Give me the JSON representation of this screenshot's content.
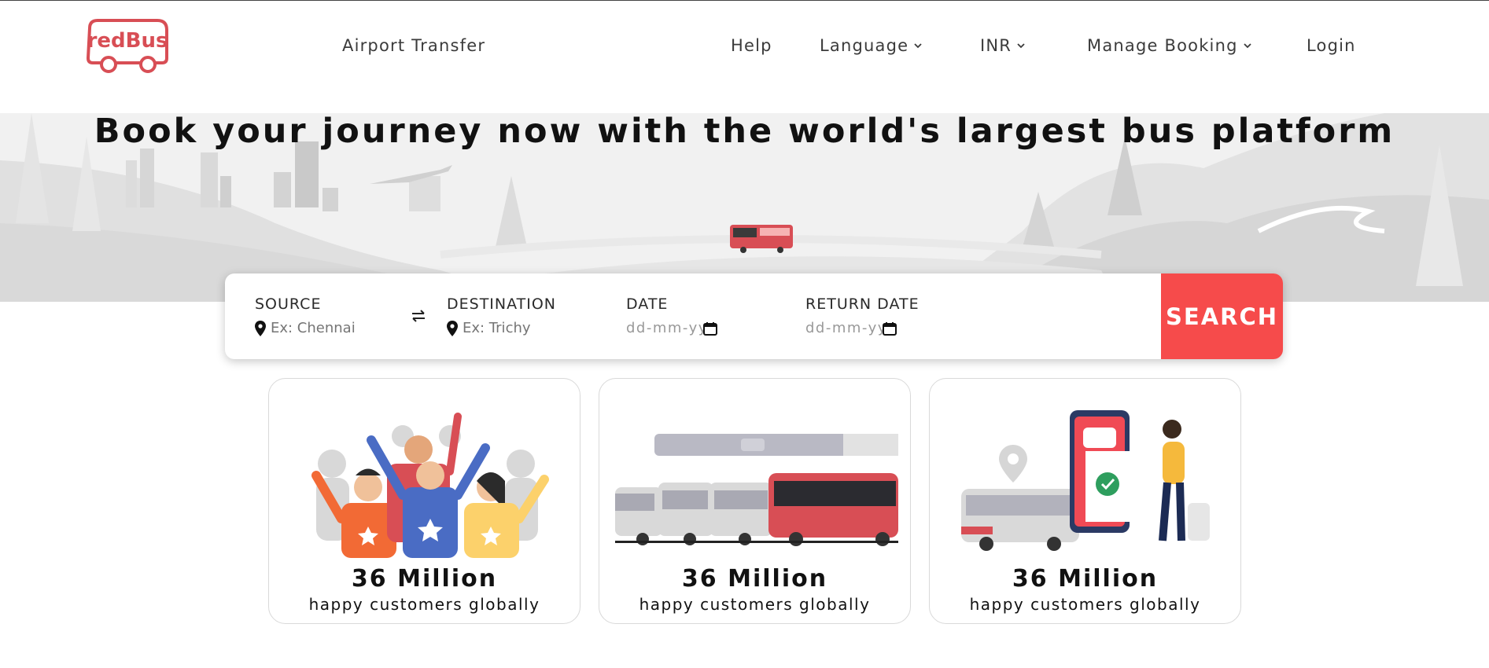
{
  "header": {
    "logo_text": "redBus",
    "nav": {
      "airport_transfer": "Airport Transfer",
      "help": "Help",
      "language": "Language",
      "currency": "INR",
      "manage_booking": "Manage Booking",
      "login": "Login"
    }
  },
  "hero": {
    "headline": "Book your journey now with the world's largest bus platform"
  },
  "search": {
    "source_label": "SOURCE",
    "source_placeholder": "Ex: Chennai",
    "destination_label": "DESTINATION",
    "destination_placeholder": "Ex: Trichy",
    "date_label": "DATE",
    "date_placeholder": "dd-mm-yyyy",
    "return_date_label": "RETURN DATE",
    "return_date_placeholder": "dd-mm-yyyy",
    "search_button": "SEARCH"
  },
  "stats": [
    {
      "value": "36 Million",
      "caption": "happy customers globally",
      "illustration": "happy-customers"
    },
    {
      "value": "36 Million",
      "caption": "happy customers globally",
      "illustration": "bus-fleet"
    },
    {
      "value": "36 Million",
      "caption": "happy customers globally",
      "illustration": "mobile-ticket"
    }
  ],
  "colors": {
    "brand_red": "#f64b4b",
    "logo_red": "#d84e55",
    "text_dark": "#111111",
    "nav_text": "#3b3b3b"
  },
  "icons": [
    "chevron-down-icon",
    "location-pin-icon",
    "swap-icon",
    "calendar-icon"
  ]
}
